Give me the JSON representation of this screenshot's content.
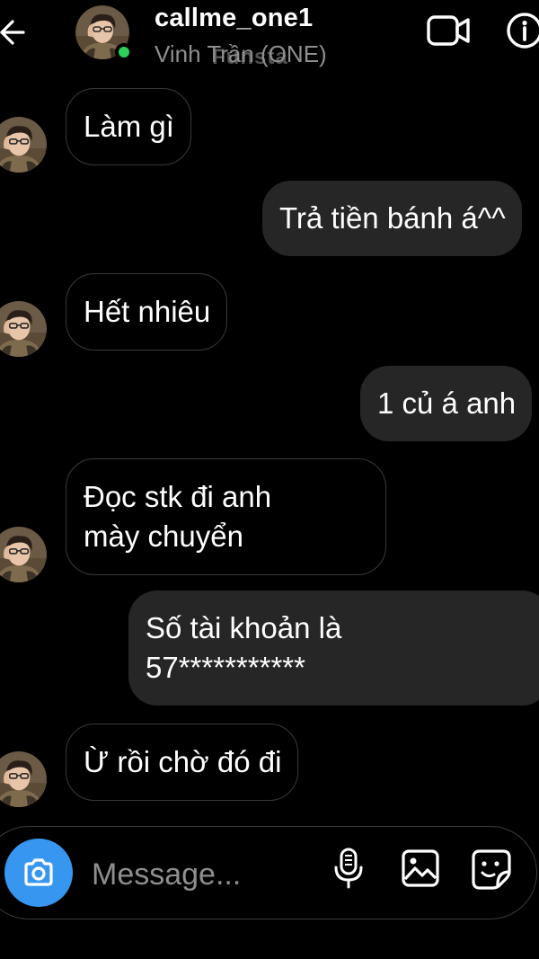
{
  "header": {
    "username": "callme_one1",
    "full_name": "Vinh Trần (ONE)",
    "watermark": "Funsta",
    "online_color": "#2bcf5a",
    "icons": [
      "arrow-left-icon",
      "video-camera-icon",
      "info-icon"
    ]
  },
  "messages": [
    {
      "from": "them",
      "text": "Làm gì"
    },
    {
      "from": "me",
      "text": "Trả tiền bánh á^^"
    },
    {
      "from": "them",
      "text": "Hết nhiêu"
    },
    {
      "from": "me",
      "text": "1 củ á anh"
    },
    {
      "from": "them",
      "lines": [
        "Đọc stk đi anh",
        "mày chuyển"
      ]
    },
    {
      "from": "me",
      "lines": [
        "Số tài khoản là",
        "57***********"
      ]
    },
    {
      "from": "them",
      "text": "Ừ rồi chờ đó đi"
    }
  ],
  "composer": {
    "placeholder": "Message...",
    "accent_color": "#3797f0",
    "icons": [
      "camera-icon",
      "microphone-icon",
      "gallery-icon",
      "sticker-icon"
    ]
  }
}
